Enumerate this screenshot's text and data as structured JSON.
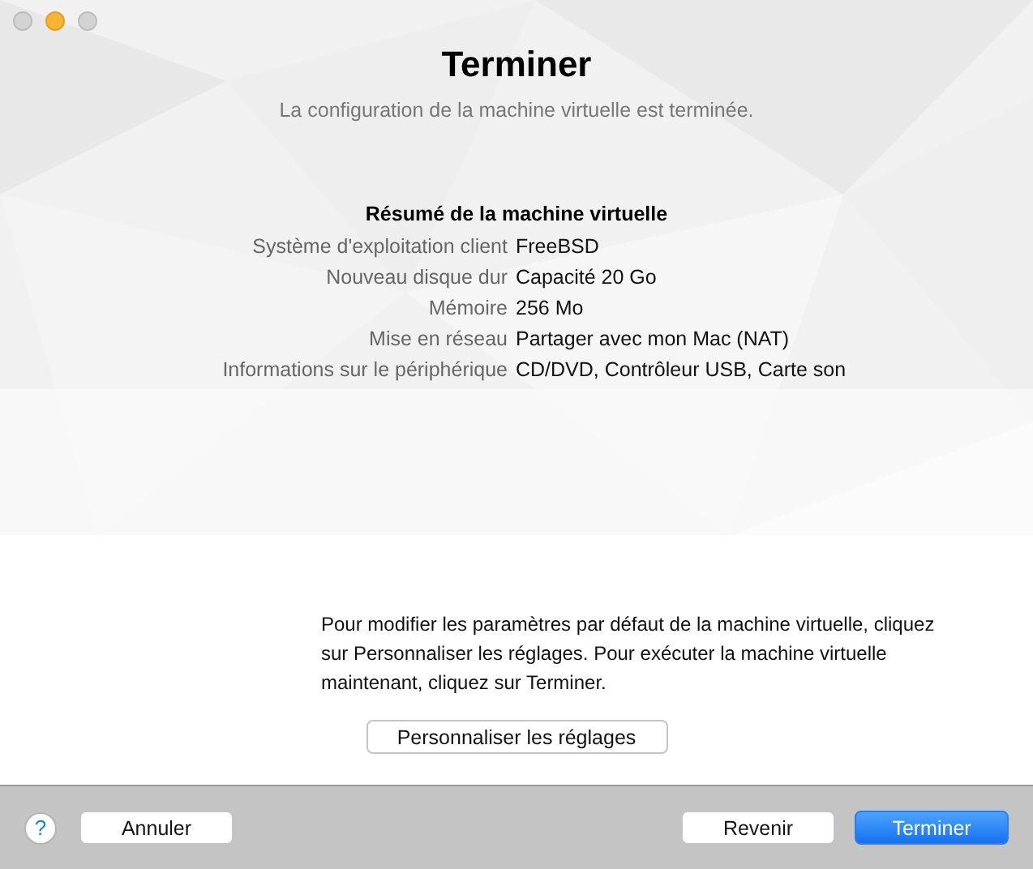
{
  "header": {
    "title": "Terminer",
    "subtitle": "La configuration de la machine virtuelle est terminée."
  },
  "summary": {
    "heading": "Résumé de la machine virtuelle",
    "rows": [
      {
        "label": "Système d'exploitation client",
        "value": "FreeBSD"
      },
      {
        "label": "Nouveau disque dur",
        "value": "Capacité 20 Go"
      },
      {
        "label": "Mémoire",
        "value": "256 Mo"
      },
      {
        "label": "Mise en réseau",
        "value": "Partager avec mon Mac (NAT)"
      },
      {
        "label": "Informations sur le périphérique",
        "value": "CD/DVD, Contrôleur USB, Carte son"
      }
    ]
  },
  "note": "Pour modifier les paramètres par défaut de la machine virtuelle, cliquez sur Personnaliser les réglages. Pour exécuter la machine virtuelle maintenant, cliquez sur Terminer.",
  "customize_button": "Personnaliser les réglages",
  "footer": {
    "help": "?",
    "buttons": [
      {
        "label": "Annuler",
        "kind": "normal"
      },
      {
        "label": "Revenir",
        "kind": "normal"
      },
      {
        "label": "Terminer",
        "kind": "default"
      }
    ]
  }
}
